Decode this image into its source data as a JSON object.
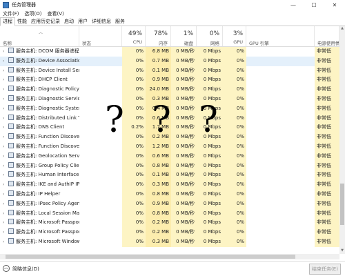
{
  "window": {
    "title": "任务管理器",
    "controls": [
      "—",
      "☐",
      "✕"
    ]
  },
  "menu": [
    "文件(F)",
    "选项(O)",
    "查看(V)"
  ],
  "tabs": [
    {
      "label": "进程",
      "active": true
    },
    {
      "label": "性能",
      "active": false
    },
    {
      "label": "应用历史记录",
      "active": false
    },
    {
      "label": "启动",
      "active": false
    },
    {
      "label": "用户",
      "active": false
    },
    {
      "label": "详细信息",
      "active": false
    },
    {
      "label": "服务",
      "active": false
    }
  ],
  "columns": {
    "name": {
      "label": "名称"
    },
    "status": {
      "label": "状态"
    },
    "cpu": {
      "pct": "49%",
      "label": "CPU"
    },
    "memory": {
      "pct": "78%",
      "label": "内存"
    },
    "disk": {
      "pct": "1%",
      "label": "磁盘"
    },
    "network": {
      "pct": "0%",
      "label": "网络"
    },
    "gpu": {
      "pct": "3%",
      "label": "GPU"
    },
    "gpu_engine": {
      "label": "GPU 引擎"
    },
    "power": {
      "label": "电源使用情况"
    }
  },
  "rows": [
    {
      "name": "服务主机: DCOM 服务器进程...",
      "cpu": "0%",
      "memory": "6.8 MB",
      "disk": "0 MB/秒",
      "network": "0 Mbps",
      "gpu": "0%",
      "power": "非常低"
    },
    {
      "name": "服务主机: Device Association ...",
      "cpu": "0%",
      "memory": "0.7 MB",
      "disk": "0 MB/秒",
      "network": "0 Mbps",
      "gpu": "0%",
      "power": "非常低"
    },
    {
      "name": "服务主机: Device Install Service",
      "cpu": "0%",
      "memory": "0.1 MB",
      "disk": "0 MB/秒",
      "network": "0 Mbps",
      "gpu": "0%",
      "power": "非常低"
    },
    {
      "name": "服务主机: DHCP Client",
      "cpu": "0%",
      "memory": "0.9 MB",
      "disk": "0 MB/秒",
      "network": "0 Mbps",
      "gpu": "0%",
      "power": "非常低"
    },
    {
      "name": "服务主机: Diagnostic Policy S...",
      "cpu": "0%",
      "memory": "24.0 MB",
      "disk": "0 MB/秒",
      "network": "0 Mbps",
      "gpu": "0%",
      "power": "非常低"
    },
    {
      "name": "服务主机: Diagnostic Service ...",
      "cpu": "0%",
      "memory": "0.3 MB",
      "disk": "0 MB/秒",
      "network": "0 Mbps",
      "gpu": "0%",
      "power": "非常低"
    },
    {
      "name": "服务主机: Diagnostic System ...",
      "cpu": "0%",
      "memory": "0.4 MB",
      "disk": "0 MB/秒",
      "network": "0 Mbps",
      "gpu": "0%",
      "power": "非常低"
    },
    {
      "name": "服务主机: Distributed Link Tra...",
      "cpu": "0%",
      "memory": "0.6 MB",
      "disk": "0 MB/秒",
      "network": "0 Mbps",
      "gpu": "0%",
      "power": "非常低"
    },
    {
      "name": "服务主机: DNS Client",
      "cpu": "0.2%",
      "memory": "1.7 MB",
      "disk": "0 MB/秒",
      "network": "0 Mbps",
      "gpu": "0%",
      "power": "非常低"
    },
    {
      "name": "服务主机: Function Discovery ...",
      "cpu": "0%",
      "memory": "0.2 MB",
      "disk": "0 MB/秒",
      "network": "0 Mbps",
      "gpu": "0%",
      "power": "非常低"
    },
    {
      "name": "服务主机: Function Discovery ...",
      "cpu": "0%",
      "memory": "1.2 MB",
      "disk": "0 MB/秒",
      "network": "0 Mbps",
      "gpu": "0%",
      "power": "非常低"
    },
    {
      "name": "服务主机: Geolocation Service",
      "cpu": "0%",
      "memory": "0.6 MB",
      "disk": "0 MB/秒",
      "network": "0 Mbps",
      "gpu": "0%",
      "power": "非常低"
    },
    {
      "name": "服务主机: Group Policy Client",
      "cpu": "0%",
      "memory": "0.8 MB",
      "disk": "0 MB/秒",
      "network": "0 Mbps",
      "gpu": "0%",
      "power": "非常低"
    },
    {
      "name": "服务主机: Human Interface D...",
      "cpu": "0%",
      "memory": "0.1 MB",
      "disk": "0 MB/秒",
      "network": "0 Mbps",
      "gpu": "0%",
      "power": "非常低"
    },
    {
      "name": "服务主机: IKE and AuthIP IPse...",
      "cpu": "0%",
      "memory": "0.3 MB",
      "disk": "0 MB/秒",
      "network": "0 Mbps",
      "gpu": "0%",
      "power": "非常低"
    },
    {
      "name": "服务主机: IP Helper",
      "cpu": "0%",
      "memory": "0.8 MB",
      "disk": "0 MB/秒",
      "network": "0 Mbps",
      "gpu": "0%",
      "power": "非常低"
    },
    {
      "name": "服务主机: IPsec Policy Agent",
      "cpu": "0%",
      "memory": "0.9 MB",
      "disk": "0 MB/秒",
      "network": "0 Mbps",
      "gpu": "0%",
      "power": "非常低"
    },
    {
      "name": "服务主机: Local Session Man...",
      "cpu": "0%",
      "memory": "0.8 MB",
      "disk": "0 MB/秒",
      "network": "0 Mbps",
      "gpu": "0%",
      "power": "非常低"
    },
    {
      "name": "服务主机: Microsoft Passport",
      "cpu": "0%",
      "memory": "0.2 MB",
      "disk": "0 MB/秒",
      "network": "0 Mbps",
      "gpu": "0%",
      "power": "非常低"
    },
    {
      "name": "服务主机: Microsoft Passport ...",
      "cpu": "0%",
      "memory": "0.2 MB",
      "disk": "0 MB/秒",
      "network": "0 Mbps",
      "gpu": "0%",
      "power": "非常低"
    },
    {
      "name": "服务主机: Microsoft Windows...",
      "cpu": "0%",
      "memory": "0.3 MB",
      "disk": "0 MB/秒",
      "network": "0 Mbps",
      "gpu": "0%",
      "power": "非常低"
    }
  ],
  "selected_row": 1,
  "overlay": [
    "?",
    "?",
    "?"
  ],
  "statusbar": {
    "collapse_label": "简略信息(D)",
    "end_task_label": "结束任务(E)"
  }
}
